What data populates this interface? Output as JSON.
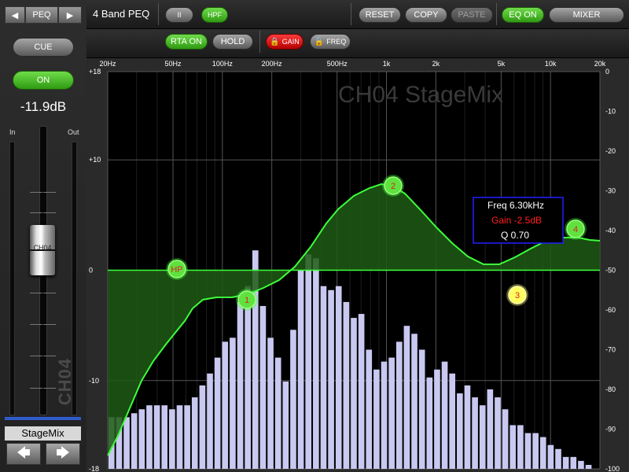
{
  "left": {
    "peq_label": "PEQ",
    "prev_arrow": "◀",
    "next_arrow": "▶",
    "cue_label": "CUE",
    "on_label": "ON",
    "gain_value": "-11.9dB",
    "in_label": "In",
    "out_label": "Out",
    "fader_name": "CH04",
    "channel_vertical": "CH04",
    "channel_name": "StageMix",
    "left_arrow": "🡄",
    "right_arrow": "🡆"
  },
  "toolbar": {
    "title": "4 Band PEQ",
    "ii_label": "II",
    "hpf_label": "HPF",
    "reset_label": "RESET",
    "copy_label": "COPY",
    "paste_label": "PASTE",
    "eq_on_label": "EQ ON",
    "mixer_label": "MIXER",
    "rta_on_label": "RTA ON",
    "hold_label": "HOLD",
    "gain_lock_label": "GAIN",
    "freq_lock_label": "FREQ"
  },
  "graph": {
    "watermark": "CH04 StageMix",
    "freq_labels": [
      "20Hz",
      "50Hz",
      "100Hz",
      "200Hz",
      "500Hz",
      "1k",
      "2k",
      "5k",
      "10k",
      "20k"
    ],
    "gain_labels": [
      "+18",
      "+10",
      "0",
      "-10",
      "-18"
    ],
    "rta_labels": [
      "0",
      "-10",
      "-20",
      "-30",
      "-40",
      "-50",
      "-60",
      "-70",
      "-80",
      "-90",
      "-100"
    ],
    "handles": [
      "HP",
      "1",
      "2",
      "3",
      "4"
    ],
    "info": {
      "freq": "Freq  6.30kHz",
      "gain": "Gain -2.5dB",
      "q": "Q  0.70"
    },
    "colors": {
      "curve": "#3cff3c",
      "fill": "#1e5a14",
      "rta_bar": "#c8c8f0",
      "selected_handle": "#ffff60",
      "info_border": "#2020ff"
    },
    "rta_levels_db": [
      -87,
      -87,
      -87,
      -86,
      -85,
      -84,
      -84,
      -84,
      -85,
      -84,
      -84,
      -82,
      -79,
      -76,
      -72,
      -68,
      -67,
      -58,
      -54,
      -45,
      -59,
      -67,
      -72,
      -78,
      -65,
      -50,
      -46,
      -47,
      -54,
      -55,
      -54,
      -58,
      -62,
      -61,
      -70,
      -75,
      -73,
      -72,
      -68,
      -64,
      -66,
      -70,
      -77,
      -75,
      -73,
      -76,
      -81,
      -79,
      -82,
      -84,
      -80,
      -82,
      -85,
      -89,
      -89,
      -91,
      -91,
      -92,
      -94,
      -95,
      -97,
      -97,
      -98,
      -99,
      -100
    ]
  }
}
